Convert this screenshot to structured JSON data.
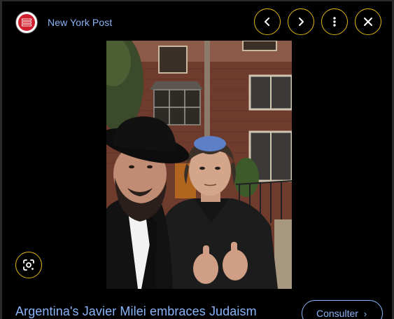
{
  "header": {
    "source_name": "New York Post",
    "logo_text": "NEW YORK POST"
  },
  "icons": {
    "prev": "chevron-left-icon",
    "next": "chevron-right-icon",
    "more": "more-vert-icon",
    "close": "close-icon",
    "lens": "google-lens-icon"
  },
  "article": {
    "headline": "Argentina's Javier Milei embraces Judaism",
    "visit_label": "Consulter"
  },
  "colors": {
    "background": "#000000",
    "link": "#8ab4f8",
    "focus_ring": "#e2b714",
    "logo_red": "#d01f2e"
  }
}
